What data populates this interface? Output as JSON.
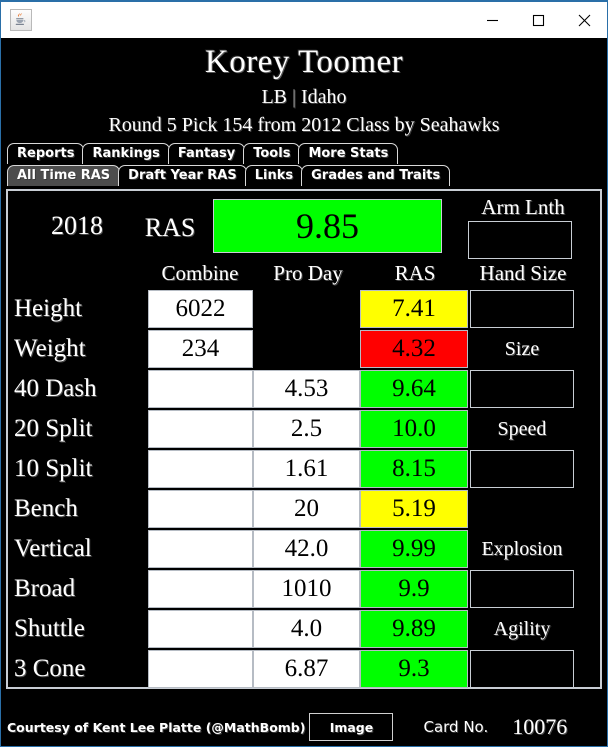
{
  "window": {
    "app_icon": "java-coffee-cup-icon",
    "minimize_label": "minimize-icon",
    "maximize_label": "maximize-icon",
    "close_label": "close-icon"
  },
  "header": {
    "player_name": "Korey Toomer",
    "position": "LB",
    "separator": "|",
    "school": "Idaho",
    "draft_line": "Round 5 Pick 154 from 2012 Class by Seahawks"
  },
  "tabs_row1": [
    {
      "label": "Reports",
      "selected": false
    },
    {
      "label": "Rankings",
      "selected": false
    },
    {
      "label": "Fantasy",
      "selected": false
    },
    {
      "label": "Tools",
      "selected": false
    },
    {
      "label": "More Stats",
      "selected": false
    }
  ],
  "tabs_row2": [
    {
      "label": "All Time RAS",
      "selected": true
    },
    {
      "label": "Draft Year RAS",
      "selected": false
    },
    {
      "label": "Links",
      "selected": false
    },
    {
      "label": "Grades and Traits",
      "selected": false
    }
  ],
  "summary": {
    "year": "2018",
    "ras_label": "RAS",
    "ras_score": "9.85",
    "ras_score_color": "#00FF00",
    "arm_length_label": "Arm Lnth",
    "arm_length_value": ""
  },
  "columns": {
    "combine": "Combine",
    "pro_day": "Pro Day",
    "ras": "RAS",
    "hand_size": "Hand Size"
  },
  "grade_labels": {
    "size": "Size",
    "speed": "Speed",
    "explosion": "Explosion",
    "agility": "Agility"
  },
  "grade_values": {
    "hand_size": "",
    "size": "",
    "speed": "",
    "explosion": "",
    "agility": ""
  },
  "rows": [
    {
      "label": "Height",
      "combine": "6022",
      "pro_day": "",
      "ras": "7.41",
      "ras_color": "#FFFF00",
      "combine_shown": true,
      "proday_shown": false
    },
    {
      "label": "Weight",
      "combine": "234",
      "pro_day": "",
      "ras": "4.32",
      "ras_color": "#FF0000",
      "combine_shown": true,
      "proday_shown": false
    },
    {
      "label": "40 Dash",
      "combine": "",
      "pro_day": "4.53",
      "ras": "9.64",
      "ras_color": "#00FF00",
      "combine_shown": true,
      "proday_shown": true
    },
    {
      "label": "20 Split",
      "combine": "",
      "pro_day": "2.5",
      "ras": "10.0",
      "ras_color": "#00FF00",
      "combine_shown": true,
      "proday_shown": true
    },
    {
      "label": "10 Split",
      "combine": "",
      "pro_day": "1.61",
      "ras": "8.15",
      "ras_color": "#00FF00",
      "combine_shown": true,
      "proday_shown": true
    },
    {
      "label": "Bench",
      "combine": "",
      "pro_day": "20",
      "ras": "5.19",
      "ras_color": "#FFFF00",
      "combine_shown": true,
      "proday_shown": true
    },
    {
      "label": "Vertical",
      "combine": "",
      "pro_day": "42.0",
      "ras": "9.99",
      "ras_color": "#00FF00",
      "combine_shown": true,
      "proday_shown": true
    },
    {
      "label": "Broad",
      "combine": "",
      "pro_day": "1010",
      "ras": "9.9",
      "ras_color": "#00FF00",
      "combine_shown": true,
      "proday_shown": true
    },
    {
      "label": "Shuttle",
      "combine": "",
      "pro_day": "4.0",
      "ras": "9.89",
      "ras_color": "#00FF00",
      "combine_shown": true,
      "proday_shown": true
    },
    {
      "label": "3 Cone",
      "combine": "",
      "pro_day": "6.87",
      "ras": "9.3",
      "ras_color": "#00FF00",
      "combine_shown": true,
      "proday_shown": true
    }
  ],
  "footer": {
    "courtesy": "Courtesy of Kent Lee Platte (@MathBomb)",
    "image_button": "Image",
    "card_no_label": "Card No.",
    "card_no_value": "10076"
  }
}
